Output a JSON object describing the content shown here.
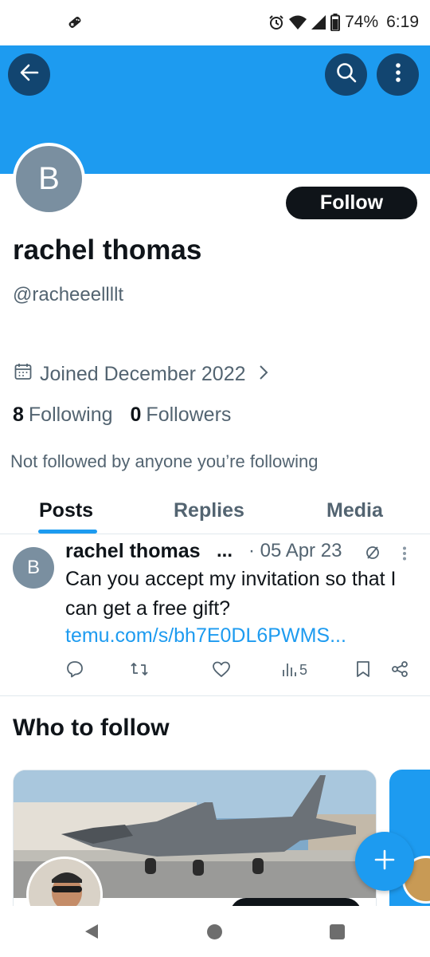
{
  "status_bar": {
    "battery": "74%",
    "time": "6:19",
    "icons": [
      "game-controller-icon",
      "alarm-icon",
      "wifi-icon",
      "cell-signal-icon",
      "battery-icon"
    ]
  },
  "header": {
    "back_icon": "back-arrow-icon",
    "search_icon": "search-icon",
    "more_icon": "more-vertical-icon",
    "banner_color": "#1d9bf0"
  },
  "profile": {
    "avatar_letter": "B",
    "follow_label": "Follow",
    "name": "rachel thomas",
    "handle": "@racheeellllt",
    "joined": "Joined December 2022",
    "following_count": "8",
    "following_label": "Following",
    "followers_count": "0",
    "followers_label": "Followers",
    "not_followed": "Not followed by anyone you’re following"
  },
  "tabs": [
    {
      "label": "Posts",
      "active": true
    },
    {
      "label": "Replies",
      "active": false
    },
    {
      "label": "Media",
      "active": false
    }
  ],
  "tweet": {
    "avatar_letter": "B",
    "name": "rachel thomas",
    "name_ellipsis": "...",
    "date": "· 05 Apr 23",
    "text": "Can you accept my invitation so that I can get a free gift?",
    "link": "temu.com/s/bh7E0DL6PWMS...",
    "views": "5"
  },
  "who_to_follow": {
    "title": "Who to follow"
  },
  "colors": {
    "accent": "#1d9bf0",
    "text_primary": "#0f1419",
    "text_secondary": "#536471"
  }
}
